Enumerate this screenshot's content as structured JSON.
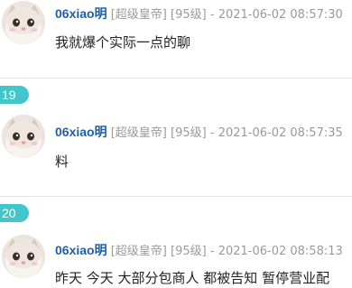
{
  "posts": [
    {
      "username": "06xiao明",
      "rank": "[超级皇帝]",
      "level": "[95级]",
      "separator": "-",
      "time": "2021-06-02 08:57:30",
      "content": "我就爆个实际一点的聊"
    },
    {
      "floor": "19",
      "username": "06xiao明",
      "rank": "[超级皇帝]",
      "level": "[95级]",
      "separator": "-",
      "time": "2021-06-02 08:57:35",
      "content": "料"
    },
    {
      "floor": "20",
      "username": "06xiao明",
      "rank": "[超级皇帝]",
      "level": "[95级]",
      "separator": "-",
      "time": "2021-06-02 08:58:13",
      "content": "昨天 今天 大部分包商人 都被告知 暂停营业",
      "content_tail": "配"
    }
  ],
  "colors": {
    "username": "#1f5fa8",
    "meta_gray": "#9a9a9a",
    "floor_badge": "#41c6cc",
    "divider": "#e4e4e4"
  },
  "icons": {
    "avatar": "cat-avatar-icon"
  }
}
